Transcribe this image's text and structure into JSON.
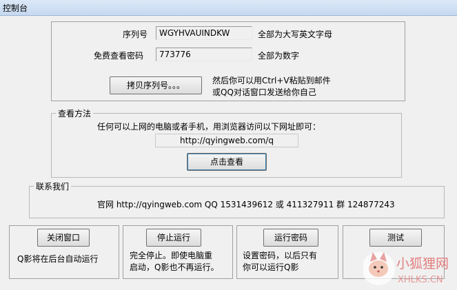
{
  "window": {
    "title": "控制台"
  },
  "serial": {
    "label": "序列号",
    "value": "WGYHVAUINDKW",
    "hint": "全部为大写英文字母"
  },
  "password": {
    "label": "免费查看密码",
    "value": "773776",
    "hint": "全部为数字"
  },
  "copy": {
    "button": "拷贝序列号。。。",
    "hint_line1": "然后你可以用Ctrl+V粘贴到邮件",
    "hint_line2": "或QQ对话窗口发送给你自己"
  },
  "view": {
    "group_title": "查看方法",
    "instruction": "任何可以上网的电脑或者手机，用浏览器访问以下网址即可：",
    "url": "http://qyingweb.com/q",
    "button": "点击查看"
  },
  "contact": {
    "group_title": "联系我们",
    "text": "官网 http://qyingweb.com QQ 1531439612 或 411327911 群 124877243"
  },
  "panels": [
    {
      "button": "关闭窗口",
      "line1": "Q影将在后台自动运行",
      "line2": ""
    },
    {
      "button": "停止运行",
      "line1": "完全停止。即使电脑重",
      "line2": "启动，Q影也不再运行。"
    },
    {
      "button": "运行密码",
      "line1": "设置密码，以后只有",
      "line2": "你可以运行Q影"
    },
    {
      "button": "测试",
      "line1": "",
      "line2": ""
    }
  ],
  "watermark": {
    "cn": "小狐狸网",
    "en": "XHLKS.CN"
  }
}
